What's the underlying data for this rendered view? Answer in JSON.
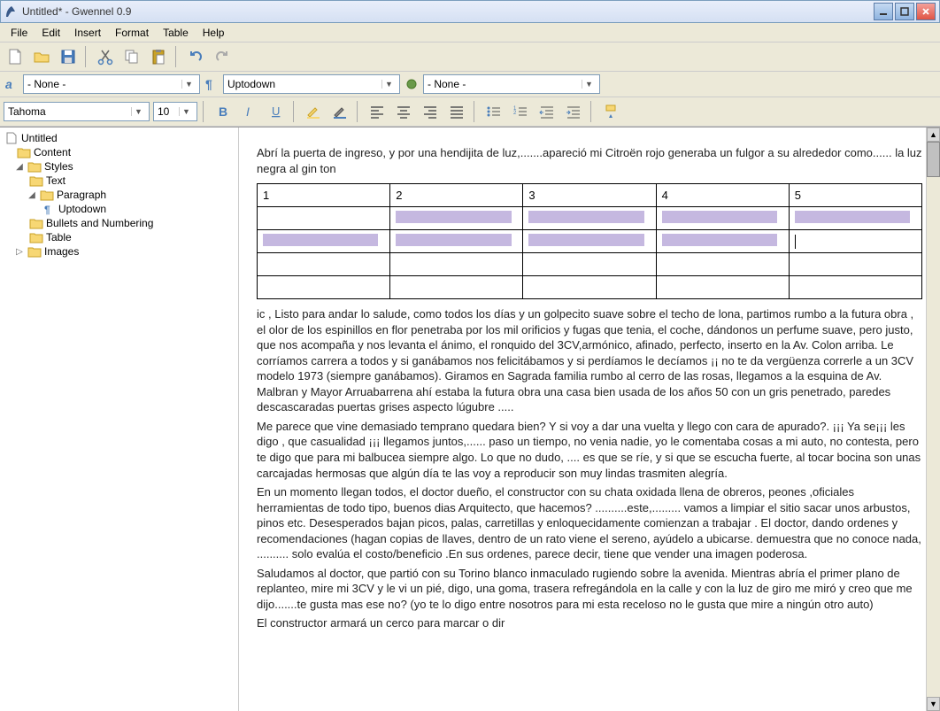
{
  "window": {
    "title": "Untitled* - Gwennel 0.9"
  },
  "menu": [
    "File",
    "Edit",
    "Insert",
    "Format",
    "Table",
    "Help"
  ],
  "styleDropdowns": {
    "style1": "- None -",
    "style2": "Uptodown",
    "style3": "- None -"
  },
  "font": {
    "name": "Tahoma",
    "size": "10"
  },
  "tree": {
    "root": "Untitled",
    "content": "Content",
    "styles": "Styles",
    "text": "Text",
    "paragraph": "Paragraph",
    "uptodown": "Uptodown",
    "bullets": "Bullets and Numbering",
    "table": "Table",
    "images": "Images"
  },
  "document": {
    "para1": "Abrí la puerta de ingreso, y por una hendijita de luz,.......apareció mi Citroën rojo generaba un fulgor a su alrededor como...... la luz negra al gin ton",
    "tableHeaders": [
      "1",
      "2",
      "3",
      "4",
      "5"
    ],
    "para2": "ic , Listo para andar lo salude, como todos los días y un golpecito suave sobre el techo de lona, partimos rumbo a la futura obra , el olor de los espinillos en flor penetraba por los mil orificios y fugas que tenia, el coche, dándonos un perfume suave, pero justo, que nos acompaña y nos levanta el ánimo, el ronquido del 3CV,armónico, afinado, perfecto, inserto en la Av. Colon arriba. Le corríamos carrera a todos y si ganábamos nos felicitábamos y si perdíamos le decíamos ¡¡ no te da vergüenza correrle a un 3CV modelo 1973 (siempre ganábamos). Giramos en Sagrada familia rumbo al cerro de las rosas, llegamos a la esquina de Av. Malbran y Mayor Arruabarrena ahí estaba la futura obra una casa bien usada de los años 50 con un gris penetrado, paredes descascaradas puertas grises aspecto lúgubre .....",
    "para3": "Me parece que vine demasiado temprano quedara bien? Y si voy a dar una vuelta y llego con cara de apurado?. ¡¡¡ Ya se¡¡¡ les digo , que casualidad ¡¡¡ llegamos juntos,...... paso un tiempo, no venia nadie, yo le comentaba cosas a mi auto, no contesta, pero te digo que para mi balbucea siempre algo. Lo que no dudo, .... es que se ríe, y si que se escucha fuerte, al tocar bocina son unas carcajadas hermosas que algún día te las voy a reproducir son muy lindas trasmiten alegría.",
    "para4": "En un momento llegan todos, el doctor dueño, el constructor con su chata oxidada llena de obreros, peones ,oficiales herramientas de todo tipo, buenos dias Arquitecto, que hacemos? ..........este,......... vamos a limpiar el sitio sacar unos arbustos, pinos etc. Desesperados bajan picos, palas, carretillas y enloquecidamente comienzan a trabajar . El doctor, dando ordenes y recomendaciones (hagan copias de llaves, dentro de un rato viene el sereno, ayúdelo a ubicarse. demuestra que no conoce nada, .......... solo evalúa el costo/beneficio .En sus ordenes, parece decir, tiene que vender una imagen poderosa.",
    "para5": "Saludamos al doctor, que partió con su Torino blanco inmaculado rugiendo sobre la avenida. Mientras abría el primer plano de replanteo, mire mi 3CV y le vi un pié, digo, una goma, trasera refregándola en la calle y con la luz de giro me miró y creo que me dijo.......te gusta mas ese no? (yo te lo digo entre nosotros para mi esta receloso no le gusta que mire a ningún otro auto)",
    "para6": "El constructor armará un cerco para marcar o dir"
  }
}
